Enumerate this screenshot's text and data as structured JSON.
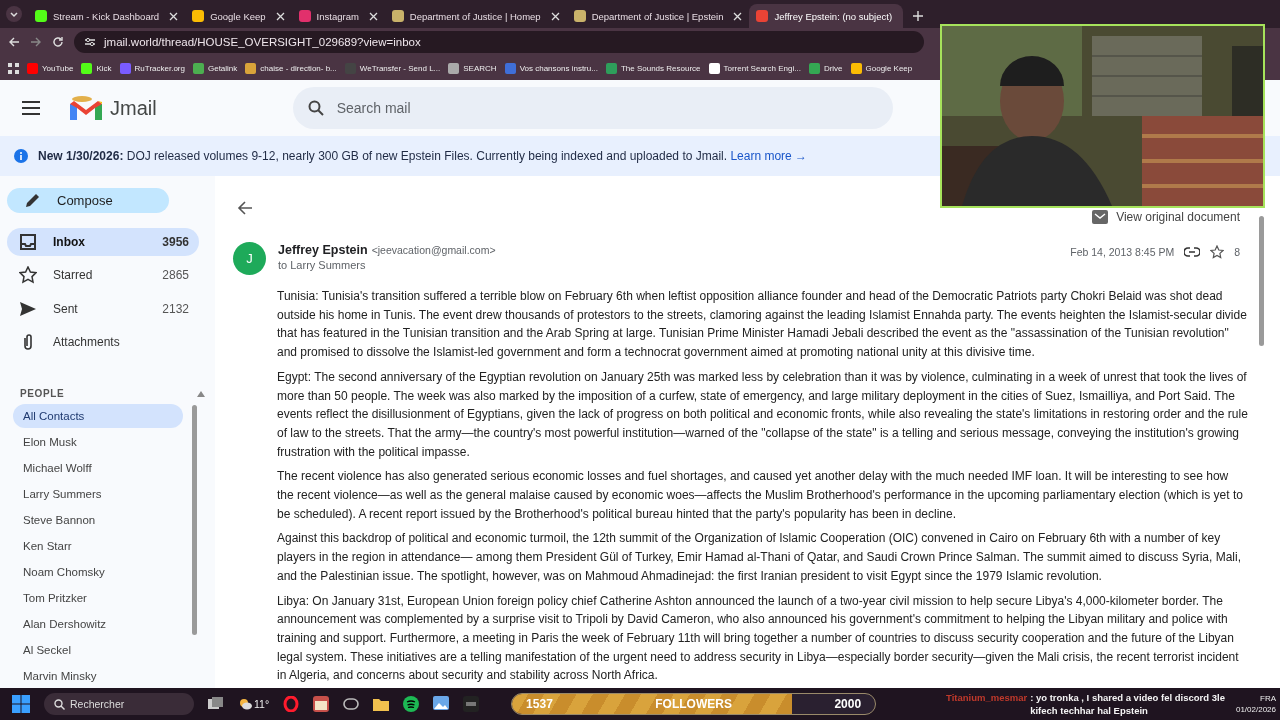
{
  "browser": {
    "tabs": [
      {
        "title": "Stream - Kick Dashboard",
        "selected": false
      },
      {
        "title": "Google Keep",
        "selected": false
      },
      {
        "title": "Instagram",
        "selected": false
      },
      {
        "title": "Department of Justice | Homep",
        "selected": false
      },
      {
        "title": "Department of Justice | Epstein",
        "selected": false
      },
      {
        "title": "Jeffrey Epstein: (no subject)",
        "selected": true
      }
    ],
    "address": "jmail.world/thread/HOUSE_OVERSIGHT_029689?view=inbox",
    "bookmarks": [
      "YouTube",
      "Kick",
      "RuTracker.org",
      "Getalink",
      "chaise - direction- b...",
      "WeTransfer - Send L...",
      "SEARCH",
      "Vos chansons instru...",
      "The Sounds Resource",
      "Torrent Search Engi...",
      "Drive",
      "Google Keep"
    ]
  },
  "app": {
    "name": "Jmail",
    "search_placeholder": "Search mail"
  },
  "banner": {
    "text": "**New 1/30/2026:** DOJ released volumes 9-12, nearly 300 GB of new Epstein Files. Currently being indexed and uploaded to Jmail.",
    "link": "Learn more →"
  },
  "compose": "Compose",
  "folders": [
    {
      "label": "Inbox",
      "count": "3956",
      "selected": true
    },
    {
      "label": "Starred",
      "count": "2865",
      "selected": false
    },
    {
      "label": "Sent",
      "count": "2132",
      "selected": false
    },
    {
      "label": "Attachments",
      "selected": false
    }
  ],
  "people": {
    "heading": "PEOPLE",
    "contacts": [
      {
        "name": "All Contacts",
        "selected": true
      },
      {
        "name": "Elon Musk",
        "selected": false
      },
      {
        "name": "Michael Wolff",
        "selected": false
      },
      {
        "name": "Larry Summers",
        "selected": false
      },
      {
        "name": "Steve Bannon",
        "selected": false
      },
      {
        "name": "Ken Starr",
        "selected": false
      },
      {
        "name": "Noam Chomsky",
        "selected": false
      },
      {
        "name": "Tom Pritzker",
        "selected": false
      },
      {
        "name": "Alan Dershowitz",
        "selected": false
      },
      {
        "name": "Al Seckel",
        "selected": false
      },
      {
        "name": "Marvin Minsky",
        "selected": false
      }
    ]
  },
  "email": {
    "view_original": "View original document",
    "avatar": "J",
    "sender": "Jeffrey Epstein",
    "address": "<jeevacation@gmail.com>",
    "to": "to Larry Summers",
    "date": "Feb 14, 2013 8:45 PM",
    "star_count": "8",
    "starred": false,
    "paragraphs": [
      "Tunisia: Tunisia's transition suffered a terrible blow on February 6th when leftist opposition alliance founder and head of the Democratic Patriots party Chokri Belaid was shot dead outside his home in Tunis. The event drew thousands of protestors to the streets, clamoring against the leading Islamist Ennahda party. The events heighten the Islamist-secular divide that has featured in the Tunisian transition and the Arab Spring at large. Tunisian Prime Minister Hamadi Jebali described the event as the \"assassination of the Tunisian revolution\" and promised to dissolve the Islamist-led government and form a technocrat government aimed at promoting national unity at this divisive time.",
      "Egypt: The second anniversary of the Egyptian revolution on January 25th was marked less by celebration than it was by violence, culminating in a week of unrest that took the lives of more than 50 people. The week was also marked by the imposition of a curfew, state of emergency, and large military deployment in the cities of Suez, Ismailliya, and Port Said. The events reflect the disillusionment of Egyptians, given the lack of progress on both political and economic fronts, while also revealing the state's limitations in restoring order and the rule of law to the streets. That the army—the country's most powerful institution—warned of the \"collapse of the state\" is a telling and serious message, conveying the institution's growing frustration with the political impasse.",
      "The recent violence has also generated serious economic losses and fuel shortages, and caused yet another delay with the much needed IMF loan. It will be interesting to see how the recent violence—as well as the general malaise caused by economic woes—affects the Muslim Brotherhood's performance in the upcoming parliamentary election (which is yet to be scheduled). A recent report issued by the Brotherhood's political bureau hinted that the party's popularity has been in decline.",
      "Against this backdrop of political and economic turmoil, the 12th summit of the Organization of Islamic Cooperation (OIC) convened in Cairo on February 6th with a number of key players in the region in attendance— among them President Gül of Turkey, Emir Hamad al-Thani of Qatar, and Saudi Crown Prince Salman. The summit aimed to discuss Syria, Mali, and the Palestinian issue. The spotlight, however, was on Mahmoud Ahmadinejad: the first Iranian president to visit Egypt since the 1979 Islamic revolution.",
      "Libya: On January 31st, European Union foreign policy chief Catherine Ashton announced the launch of a two-year civil mission to help secure Libya's 4,000-kilometer border. The announcement was complemented by a surprise visit to Tripoli by David Cameron, who also announced his government's commitment to helping the Libyan military and police with training and support. Furthermore, a meeting in Paris the week of February 11th will bring together a number of countries to discuss security cooperation and the future of the Libyan legal system. These initiatives are a telling manifestation of the urgent need to address security in Libya—especially border security—given the Mali crisis, the recent terrorist incident in Algeria, and concerns about security and stability across North Africa."
    ]
  },
  "stream": {
    "followers": {
      "current": "1537",
      "label": "FOLLOWERS",
      "goal": "2000",
      "level": 0.77
    },
    "chat": [
      {
        "user": "Titanium_mesmar",
        "message": ": yo tronka , I shared a video fel discord 3le kifech techhar hal Epstein",
        "color": "#c0392b"
      }
    ]
  },
  "taskbar": {
    "search_placeholder": "Rechercher",
    "weather": "11°",
    "language": "FRA",
    "date": "01/02/2026"
  }
}
